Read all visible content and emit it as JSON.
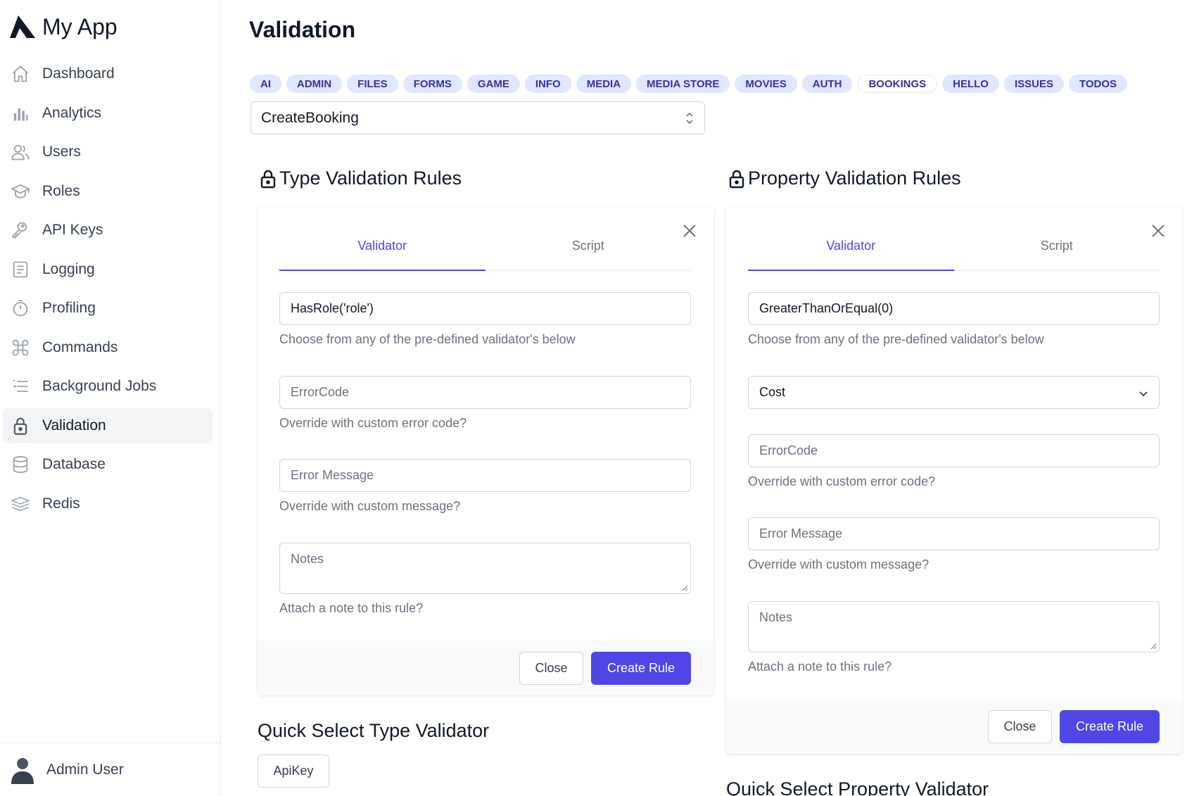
{
  "app": {
    "name": "My App"
  },
  "sidebar": {
    "items": [
      {
        "label": "Dashboard",
        "icon": "home-icon"
      },
      {
        "label": "Analytics",
        "icon": "bar-chart-icon"
      },
      {
        "label": "Users",
        "icon": "users-icon"
      },
      {
        "label": "Roles",
        "icon": "graduation-cap-icon"
      },
      {
        "label": "API Keys",
        "icon": "key-icon"
      },
      {
        "label": "Logging",
        "icon": "log-icon"
      },
      {
        "label": "Profiling",
        "icon": "stopwatch-icon"
      },
      {
        "label": "Commands",
        "icon": "command-icon"
      },
      {
        "label": "Background Jobs",
        "icon": "list-indent-icon"
      },
      {
        "label": "Validation",
        "icon": "lock-icon",
        "active": true
      },
      {
        "label": "Database",
        "icon": "database-icon"
      },
      {
        "label": "Redis",
        "icon": "layers-icon"
      }
    ],
    "user": {
      "name": "Admin User"
    }
  },
  "page": {
    "title": "Validation"
  },
  "chips": [
    "AI",
    "ADMIN",
    "FILES",
    "FORMS",
    "GAME",
    "INFO",
    "MEDIA",
    "MEDIA STORE",
    "MOVIES",
    "AUTH",
    "BOOKINGS",
    "HELLO",
    "ISSUES",
    "TODOS"
  ],
  "selected_chip": "BOOKINGS",
  "operation_select": {
    "value": "CreateBooking"
  },
  "type_rules": {
    "heading": "Type Validation Rules",
    "tabs": {
      "validator": "Validator",
      "script": "Script"
    },
    "validator_value": "HasRole('role')",
    "validator_hint": "Choose from any of the pre-defined validator's below",
    "error_code_placeholder": "ErrorCode",
    "error_code_hint": "Override with custom error code?",
    "error_message_placeholder": "Error Message",
    "error_message_hint": "Override with custom message?",
    "notes_placeholder": "Notes",
    "notes_hint": "Attach a note to this rule?",
    "close_label": "Close",
    "create_label": "Create Rule"
  },
  "property_rules": {
    "heading": "Property Validation Rules",
    "tabs": {
      "validator": "Validator",
      "script": "Script"
    },
    "validator_value": "GreaterThanOrEqual(0)",
    "validator_hint": "Choose from any of the pre-defined validator's below",
    "property_select": "Cost",
    "error_code_placeholder": "ErrorCode",
    "error_code_hint": "Override with custom error code?",
    "error_message_placeholder": "Error Message",
    "error_message_hint": "Override with custom message?",
    "notes_placeholder": "Notes",
    "notes_hint": "Attach a note to this rule?",
    "close_label": "Close",
    "create_label": "Create Rule"
  },
  "quick_type": {
    "title": "Quick Select Type Validator",
    "items": [
      "ApiKey"
    ]
  },
  "quick_property": {
    "title": "Quick Select Property Validator"
  },
  "colors": {
    "accent": "#4f46e5",
    "chip_bg": "#e0e7ff",
    "chip_text": "#3730a3"
  }
}
